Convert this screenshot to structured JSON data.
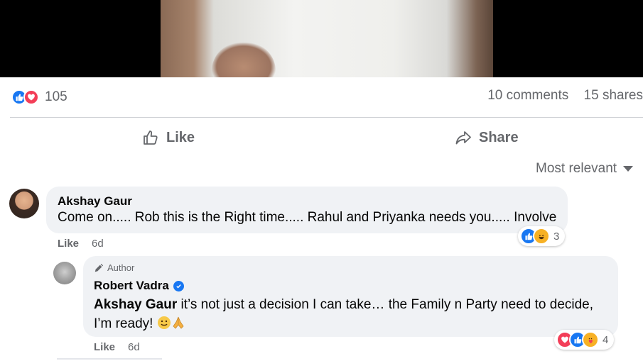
{
  "post": {
    "reaction_icons": [
      "like-icon",
      "love-icon"
    ],
    "reaction_count": "105",
    "comments_count": "10 comments",
    "shares_count": "15 shares",
    "actions": {
      "like_label": "Like",
      "share_label": "Share"
    },
    "sort_label": "Most relevant"
  },
  "comments": [
    {
      "author": "Akshay Gaur",
      "text": "Come on..... Rob this is the Right time..... Rahul and Priyanka needs you..... Involve",
      "reactions": {
        "icons": [
          "like-icon",
          "haha-icon"
        ],
        "count": "3"
      },
      "like_label": "Like",
      "time": "6d"
    },
    {
      "badge": "Author",
      "author": "Robert Vadra",
      "verified": true,
      "mention": "Akshay Gaur",
      "text": " it’s not just a decision I can take… the Family n Party need to decide, I’m ready! ",
      "emojis": [
        "smile-emoji",
        "folded-hands-emoji"
      ],
      "reactions": {
        "icons": [
          "love-icon",
          "like-icon",
          "care-icon"
        ],
        "count": "4"
      },
      "like_label": "Like",
      "time": "6d"
    }
  ],
  "colors": {
    "like_blue": "#1877f2",
    "love_red": "#f33e58",
    "haha_yellow": "#f7b125",
    "muted_text": "#65676b",
    "bubble_bg": "#f0f2f5"
  }
}
